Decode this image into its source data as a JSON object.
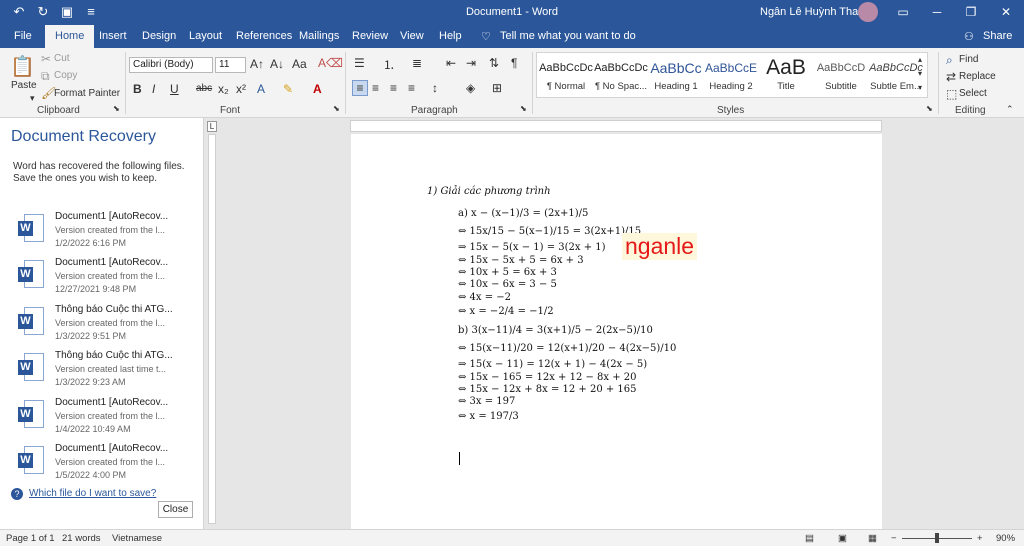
{
  "window": {
    "title": "Document1 - Word",
    "user": "Ngân Lê Huỳnh Thanh",
    "buttons": [
      "ribbon-display-icon",
      "minimize-icon",
      "restore-icon",
      "close-icon"
    ]
  },
  "tabs": {
    "items": [
      {
        "label": "File"
      },
      {
        "label": "Home"
      },
      {
        "label": "Insert"
      },
      {
        "label": "Design"
      },
      {
        "label": "Layout"
      },
      {
        "label": "References"
      },
      {
        "label": "Mailings"
      },
      {
        "label": "Review"
      },
      {
        "label": "View"
      },
      {
        "label": "Help"
      }
    ],
    "active": "Home",
    "tell_me": "Tell me what you want to do",
    "share": "Share"
  },
  "ribbon": {
    "clipboard": {
      "paste": "Paste",
      "cut": "Cut",
      "copy": "Copy",
      "format_painter": "Format Painter",
      "label": "Clipboard"
    },
    "font": {
      "family": "Calibri (Body)",
      "size": "11",
      "label": "Font"
    },
    "paragraph": {
      "label": "Paragraph"
    },
    "styles": {
      "label": "Styles",
      "items": [
        {
          "preview": "AaBbCcDc",
          "name": "¶ Normal"
        },
        {
          "preview": "AaBbCcDc",
          "name": "¶ No Spac..."
        },
        {
          "preview": "AaBbCc",
          "name": "Heading 1"
        },
        {
          "preview": "AaBbCcE",
          "name": "Heading 2"
        },
        {
          "preview": "AaB",
          "name": "Title"
        },
        {
          "preview": "AaBbCcD",
          "name": "Subtitle"
        },
        {
          "preview": "AaBbCcDc",
          "name": "Subtle Em..."
        }
      ]
    },
    "editing": {
      "find": "Find",
      "replace": "Replace",
      "select": "Select",
      "label": "Editing"
    }
  },
  "recovery": {
    "title": "Document Recovery",
    "intro": "Word has recovered the following files. Save the ones you wish to keep.",
    "files": [
      {
        "name": "Document1  [AutoRecov...",
        "desc": "Version created from the l...",
        "date": "1/2/2022 6:16 PM"
      },
      {
        "name": "Document1  [AutoRecov...",
        "desc": "Version created from the l...",
        "date": "12/27/2021 9:48 PM"
      },
      {
        "name": "Thông báo Cuộc thi ATG...",
        "desc": "Version created from the l...",
        "date": "1/3/2022 9:51 PM"
      },
      {
        "name": "Thông báo Cuộc thi ATG...",
        "desc": "Version created last time t...",
        "date": "1/3/2022 9:23 AM"
      },
      {
        "name": "Document1  [AutoRecov...",
        "desc": "Version created from the l...",
        "date": "1/4/2022 10:49 AM"
      },
      {
        "name": "Document1  [AutoRecov...",
        "desc": "Version created from the l...",
        "date": "1/5/2022 4:00 PM"
      }
    ],
    "help_link": "Which file do I want to save?",
    "close": "Close"
  },
  "document": {
    "heading": "1) Giải các phương trình",
    "lines": [
      "a) x − (x−1)/3 = (2x+1)/5",
      "⇔ 15x/15 − 5(x−1)/15 = 3(2x+1)/15",
      "⇒ 15x − 5(x − 1) = 3(2x + 1)",
      "⇔ 15x − 5x + 5 = 6x + 3",
      "⇔ 10x + 5 = 6x + 3",
      "⇔ 10x − 6x = 3 − 5",
      "⇔ 4x = −2",
      "⇔ x = −2/4 = −1/2",
      "b) 3(x−11)/4 = 3(x+1)/5 − 2(2x−5)/10",
      "⇔ 15(x−11)/20 = 12(x+1)/20 − 4(2x−5)/10",
      "⇒ 15(x − 11) = 12(x + 1) − 4(2x − 5)",
      "⇔ 15x − 165 = 12x + 12 − 8x + 20",
      "⇔ 15x − 12x + 8x = 12 + 20 + 165",
      "⇔ 3x = 197",
      "⇔ x = 197/3"
    ],
    "watermark": "nganle"
  },
  "status": {
    "page": "Page 1 of 1",
    "words": "21 words",
    "language": "Vietnamese",
    "zoom": "90%"
  }
}
